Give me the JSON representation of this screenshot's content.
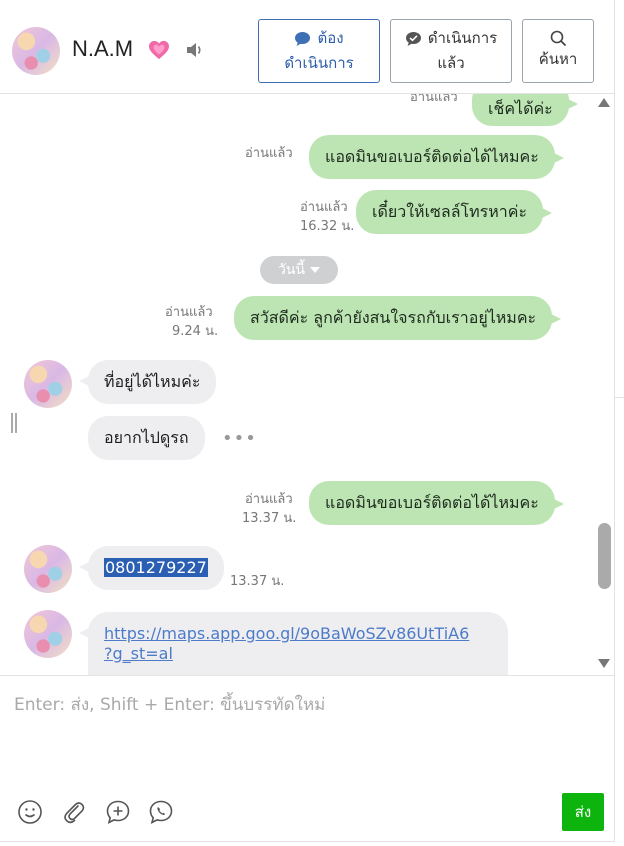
{
  "header": {
    "contact_name": "N.A.M",
    "heart_icon": "heart-icon",
    "sound_icon": "speaker-icon",
    "buttons": {
      "todo": {
        "line1": "ต้อง",
        "line2": "ดำเนินการ",
        "icon": "chat-bubble-icon",
        "color": "#2d5ea8"
      },
      "done": {
        "line1": "ดำเนินการ",
        "line2": "แล้ว",
        "icon": "check-bubble-icon"
      },
      "search": {
        "label": "ค้นหา",
        "icon": "search-icon"
      }
    }
  },
  "chat": {
    "messages": [
      {
        "dir": "out",
        "text": "เช็คได้ค่ะ",
        "read": "อ่านแล้ว",
        "time": ""
      },
      {
        "dir": "out",
        "text": "แอดมินขอเบอร์ติดต่อได้ไหมคะ",
        "read": "อ่านแล้ว",
        "time": ""
      },
      {
        "dir": "out",
        "text": "เดี๋ยวให้เซลล์โทรหาค่ะ",
        "read": "อ่านแล้ว",
        "time": "16.32 น."
      },
      {
        "dir": "out",
        "text": "สวัสดีค่ะ ลูกค้ายังสนใจรถกับเราอยู่ไหมคะ",
        "read": "อ่านแล้ว",
        "time": "9.24 น."
      },
      {
        "dir": "in",
        "text": "ที่อยู่ได้ไหมค่ะ"
      },
      {
        "dir": "in",
        "text": "อยากไปดูรถ"
      },
      {
        "dir": "out",
        "text": "แอดมินขอเบอร์ติดต่อได้ไหมคะ",
        "read": "อ่านแล้ว",
        "time": "13.37 น."
      },
      {
        "dir": "in",
        "text": "0801279227",
        "time": "13.37 น."
      },
      {
        "dir": "in",
        "link_line1": "https://maps.app.goo.gl/9oBaWoSZv86UtTiA6",
        "link_line2": "?g_st=al"
      }
    ],
    "date_divider": "วันนี้",
    "more_dots": "•••",
    "bubble_out_color": "#bde5b3",
    "bubble_in_color": "#eeeef0"
  },
  "composer": {
    "placeholder": "Enter: ส่ง, Shift + Enter: ขึ้นบรรทัดใหม่",
    "tools": [
      "emoji-icon",
      "paperclip-icon",
      "add-chat-icon",
      "phone-bubble-icon"
    ],
    "send_label": "ส่ง",
    "send_color": "#0eb40e"
  }
}
